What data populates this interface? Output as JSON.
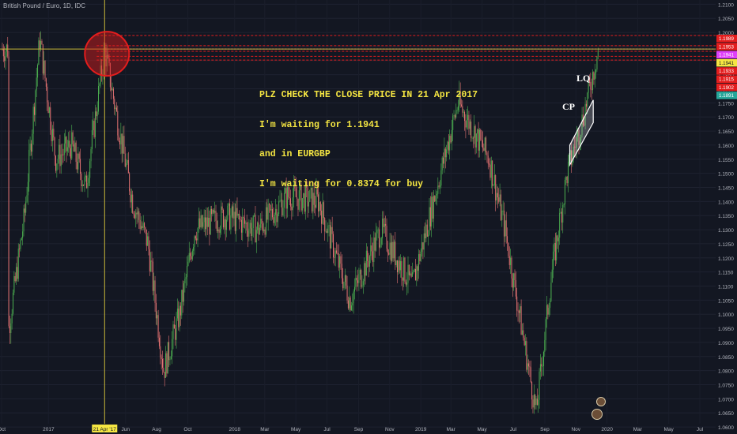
{
  "header": {
    "title": "British Pound / Euro, 1D, IDC"
  },
  "annotation": {
    "lines": [
      "PLZ CHECK THE CLOSE PRICE IN 21 Apr 2017",
      "I'm waiting for 1.1941",
      "and in EURGBP",
      "I'm waiting for 0.8374 for buy"
    ],
    "color": "#f5e642"
  },
  "drawings": {
    "cp_label": "CP",
    "lq_label": "LQ",
    "crosshair_date": "21 Apr '17"
  },
  "colors": {
    "background": "#131722",
    "up": "#26a69a",
    "down": "#ef5350",
    "candle_up": "#4caf50",
    "candle_down": "#e57373",
    "highlight_circle": "#e31d1d",
    "crosshair": "#c9b93a",
    "channel": "#ffffff"
  },
  "chart_data": {
    "type": "candlestick",
    "title": "British Pound / Euro, 1D, IDC",
    "ylim": [
      1.0575,
      1.2115
    ],
    "y_ticks": [
      "1.2100",
      "1.2050",
      "1.2000",
      "1.1950",
      "1.1900",
      "1.1850",
      "1.1800",
      "1.1750",
      "1.1700",
      "1.1650",
      "1.1600",
      "1.1550",
      "1.1500",
      "1.1450",
      "1.1400",
      "1.1350",
      "1.1300",
      "1.1250",
      "1.1200",
      "1.1150",
      "1.1100",
      "1.1050",
      "1.1000",
      "1.0950",
      "1.0900",
      "1.0850",
      "1.0800",
      "1.0750",
      "1.0700",
      "1.0650",
      "1.0600"
    ],
    "x_ticks": [
      "Oct",
      "2017",
      "21 Apr '17",
      "Jun",
      "Aug",
      "Oct",
      "2018",
      "Mar",
      "May",
      "Jul",
      "Sep",
      "Nov",
      "2019",
      "Mar",
      "May",
      "Jul",
      "Sep",
      "Nov",
      "2020",
      "Mar",
      "May",
      "Jul"
    ],
    "series_path": [
      {
        "date": "2016-10",
        "price": 1.095
      },
      {
        "date": "2016-11",
        "price": 1.135
      },
      {
        "date": "2016-12",
        "price": 1.198
      },
      {
        "date": "2017-01",
        "price": 1.155
      },
      {
        "date": "2017-02",
        "price": 1.16
      },
      {
        "date": "2017-03",
        "price": 1.145
      },
      {
        "date": "2017-04-21",
        "price": 1.1941
      },
      {
        "date": "2017-05",
        "price": 1.17
      },
      {
        "date": "2017-06",
        "price": 1.14
      },
      {
        "date": "2017-07",
        "price": 1.125
      },
      {
        "date": "2017-08",
        "price": 1.08
      },
      {
        "date": "2017-09",
        "price": 1.1
      },
      {
        "date": "2017-10",
        "price": 1.13
      },
      {
        "date": "2017-12",
        "price": 1.135
      },
      {
        "date": "2018-02",
        "price": 1.13
      },
      {
        "date": "2018-04",
        "price": 1.142
      },
      {
        "date": "2018-06",
        "price": 1.14
      },
      {
        "date": "2018-08",
        "price": 1.105
      },
      {
        "date": "2018-10",
        "price": 1.13
      },
      {
        "date": "2018-12",
        "price": 1.11
      },
      {
        "date": "2019-03",
        "price": 1.175
      },
      {
        "date": "2019-05",
        "price": 1.155
      },
      {
        "date": "2019-06",
        "price": 1.13
      },
      {
        "date": "2019-08",
        "price": 1.065
      },
      {
        "date": "2019-09",
        "price": 1.115
      },
      {
        "date": "2019-10",
        "price": 1.15
      },
      {
        "date": "2019-11",
        "price": 1.17
      },
      {
        "date": "2019-12",
        "price": 1.1941
      }
    ],
    "horizontal_levels": [
      {
        "value": 1.1989,
        "label": "1.1989",
        "color": "#e31d1d"
      },
      {
        "value": 1.1953,
        "label": "1.1953",
        "color": "#e31d1d"
      },
      {
        "value": 1.1941,
        "label": "1.1941",
        "color": "#e040fb"
      },
      {
        "value": 1.1941,
        "label": "1.1941",
        "color": "#f5e642"
      },
      {
        "value": 1.1933,
        "label": "1.1933",
        "color": "#e31d1d"
      },
      {
        "value": 1.1915,
        "label": "1.1915",
        "color": "#e31d1d"
      },
      {
        "value": 1.1902,
        "label": "1.1902",
        "color": "#e31d1d"
      },
      {
        "value": 1.1891,
        "label": "1.1891",
        "color": "#26a69a"
      }
    ],
    "channel": {
      "lower": [
        {
          "date": "2019-10-20",
          "price": 1.153
        },
        {
          "date": "2019-12-05",
          "price": 1.168
        }
      ],
      "upper": [
        {
          "date": "2019-10-20",
          "price": 1.16
        },
        {
          "date": "2019-12-05",
          "price": 1.176
        }
      ]
    },
    "crosshair": {
      "date": "2017-04-21",
      "price": 1.1941
    },
    "circle_center": {
      "date": "2017-04-21",
      "price": 1.1941
    }
  }
}
